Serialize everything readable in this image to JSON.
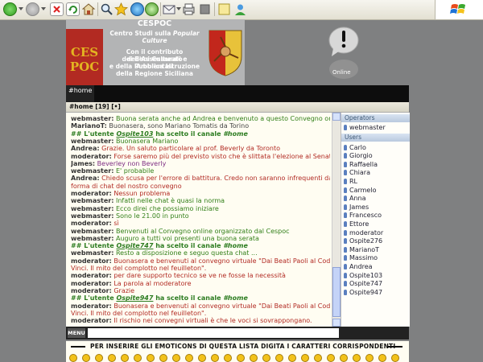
{
  "banner": {
    "logo_text_1": "CES",
    "logo_text_2": "POC",
    "title": "CESPOC",
    "subtitle_1": "Centro Studi sulla",
    "subtitle_2": "Popular Culture",
    "line_1": "Con il contributo dell'Assessorato",
    "line_2": "dei Beni Culturali e Ambientali",
    "line_3": "e della Pubblica Istruzione",
    "line_4": "della Regione Siciliana",
    "online_label": "Online"
  },
  "channel": {
    "tab": "#home",
    "header": "#home [19] [•]"
  },
  "messages": [
    {
      "nick": "webmaster:",
      "text": "Buona serata anche ad Andrea e benvenuto a questo Convegno online",
      "color": "green"
    },
    {
      "nick": "MarianoT:",
      "text": "Buonasera, sono Mariano Tomatis da Torino",
      "color": "dark"
    },
    {
      "join": true,
      "prefix": "## L'utente",
      "user": "Ospite103",
      "mid": "ha scelto il canale",
      "channel": "#home"
    },
    {
      "nick": "webmaster:",
      "text": "Buonasera Mariano",
      "color": "green"
    },
    {
      "nick": "Andrea:",
      "text": "Grazie. Un saluto particolare al prof. Beverly da Toronto",
      "color": "red"
    },
    {
      "nick": "moderator:",
      "text": "Forse saremo più del previsto visto che è slittata l'elezione al Senato...",
      "color": "red"
    },
    {
      "nick": "James:",
      "text": "Beverley non Beverly",
      "color": "purple"
    },
    {
      "nick": "webmaster:",
      "text": "E' probabile",
      "color": "green"
    },
    {
      "nick": "Andrea:",
      "text": "Chiedo scusa per l'errore di battitura. Credo non saranno infrequenti data la",
      "color": "red"
    },
    {
      "nick": "",
      "text": "forma di chat del nostro convegno",
      "color": "red"
    },
    {
      "nick": "moderator:",
      "text": "Nessun problema",
      "color": "red"
    },
    {
      "nick": "webmaster:",
      "text": "Infatti nelle chat è quasi la norma",
      "color": "green"
    },
    {
      "nick": "webmaster:",
      "text": "Ecco direi che possiamo iniziare",
      "color": "green"
    },
    {
      "nick": "webmaster:",
      "text": "Sono le 21.00 in punto",
      "color": "green"
    },
    {
      "nick": "moderator:",
      "text": "sì",
      "color": "red"
    },
    {
      "nick": "webmaster:",
      "text": "Benvenuti al Convegno online organizzato dal Cespoc",
      "color": "green"
    },
    {
      "nick": "webmaster:",
      "text": "Auguro a tutti voi presenti una buona serata",
      "color": "green"
    },
    {
      "join": true,
      "prefix": "## L'utente",
      "user": "Ospite747",
      "mid": "ha scelto il canale",
      "channel": "#home"
    },
    {
      "nick": "webmaster:",
      "text": "Resto a disposizione e seguo questa chat ...",
      "color": "green"
    },
    {
      "nick": "moderator:",
      "text": "Buonasera e benvenuti al convegno virtuale \"Dai Beati Paoli al Codice da",
      "color": "red"
    },
    {
      "nick": "",
      "text": "Vinci. Il mito del complotto nel feuilleton\".",
      "color": "red"
    },
    {
      "nick": "moderator:",
      "text": "per dare supporto tecnico se ve ne fosse la necessità",
      "color": "red"
    },
    {
      "nick": "moderator:",
      "text": "La parola al moderatore",
      "color": "red"
    },
    {
      "nick": "moderator:",
      "text": "Grazie",
      "color": "red"
    },
    {
      "join": true,
      "prefix": "## L'utente",
      "user": "Ospite947",
      "mid": "ha scelto il canale",
      "channel": "#home"
    },
    {
      "nick": "moderator:",
      "text": "Buonasera e benvenuti al convegno virtuale \"Dai Beati Paoli al Codice da",
      "color": "red"
    },
    {
      "nick": "",
      "text": "Vinci. Il mito del complotto nel feuilleton\".",
      "color": "red"
    },
    {
      "nick": "moderator:",
      "text": "Il rischio nei convegni virtuali è che le voci si sovrappongano.",
      "color": "red"
    }
  ],
  "operators_label": "Operators",
  "operators": [
    "webmaster"
  ],
  "users_label": "Users",
  "users": [
    "Carlo",
    "Giorgio",
    "Raffaella",
    "Chiara",
    "RL",
    "Carmelo",
    "Anna",
    "James",
    "Francesco",
    "Ettore",
    "moderator",
    "Ospite276",
    "MarianoT",
    "Massimo",
    "Andrea",
    "Ospite103",
    "Ospite747",
    "Ospite947"
  ],
  "input": {
    "menu_label": "MENU",
    "value": ""
  },
  "emoticons": {
    "instruction": "PER INSERIRE GLI EMOTICONS DI QUESTA LISTA DIGITA I CARATTERI CORRISPONDENTI",
    "count": 26
  },
  "colors": {
    "green": "#33801a",
    "red": "#b22b24",
    "purple": "#7d2d82",
    "dark": "#444444"
  }
}
